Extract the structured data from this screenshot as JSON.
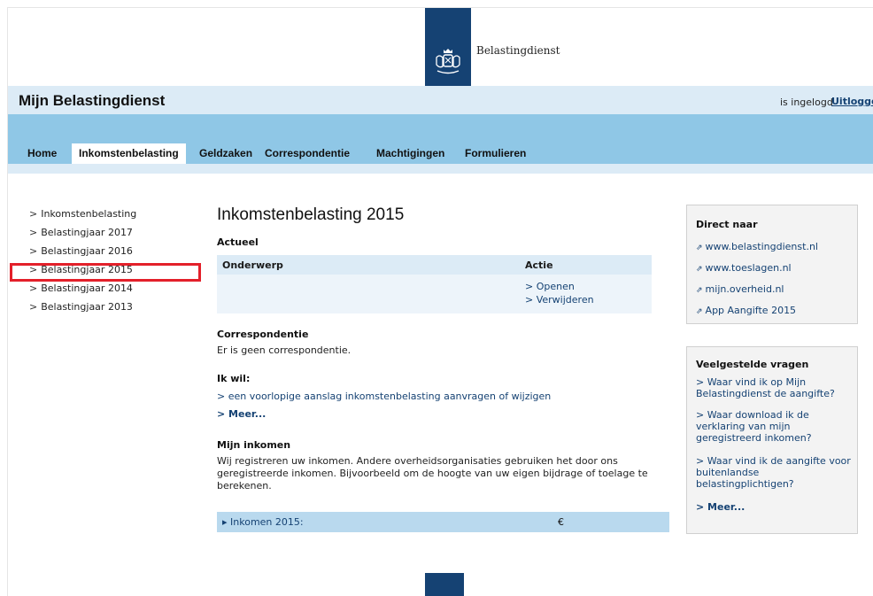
{
  "header": {
    "brand": "Belastingdienst",
    "app_title": "Mijn Belastingdienst",
    "login_status": "is ingelogd",
    "logout_label": "Uitloggen"
  },
  "nav": {
    "tabs": [
      {
        "label": "Home"
      },
      {
        "label": "Inkomstenbelasting",
        "active": true
      },
      {
        "label": "Geldzaken"
      },
      {
        "label": "Correspondentie"
      },
      {
        "label": "Machtigingen"
      },
      {
        "label": "Formulieren"
      }
    ]
  },
  "left_menu": {
    "chevron": ">",
    "items": [
      {
        "label": "Inkomstenbelasting"
      },
      {
        "label": "Belastingjaar 2017"
      },
      {
        "label": "Belastingjaar 2016"
      },
      {
        "label": "Belastingjaar 2015",
        "highlighted": true
      },
      {
        "label": "Belastingjaar 2014"
      },
      {
        "label": "Belastingjaar 2013"
      }
    ]
  },
  "main": {
    "title": "Inkomstenbelasting 2015",
    "actueel": {
      "heading": "Actueel",
      "col_subject": "Onderwerp",
      "col_action": "Actie",
      "actions": [
        "> Openen",
        "> Verwijderen"
      ]
    },
    "correspondentie": {
      "heading": "Correspondentie",
      "text": "Er is geen correspondentie."
    },
    "ik_wil": {
      "heading": "Ik wil:",
      "link": "> een voorlopige aanslag inkomstenbelasting aanvragen of wijzigen",
      "more": "> Meer..."
    },
    "inkomen": {
      "heading": "Mijn inkomen",
      "line1": "Wij registreren uw inkomen. Andere overheidsorganisaties gebruiken het door ons",
      "line2": "geregistreerde inkomen. Bijvoorbeeld om de hoogte van uw eigen bijdrage of toelage te",
      "line3": "berekenen.",
      "bar_label": "▸ Inkomen 2015:",
      "currency": "€"
    }
  },
  "sidebar": {
    "direct": {
      "title": "Direct naar",
      "ext_icon": "⇗",
      "links": [
        "www.belastingdienst.nl",
        "www.toeslagen.nl",
        "mijn.overheid.nl",
        "App Aangifte 2015"
      ]
    },
    "faq": {
      "title": "Veelgestelde vragen",
      "items": [
        "> Waar vind ik op Mijn Belastingdienst de aangifte?",
        "> Waar download ik de verklaring van mijn geregistreerd inkomen?",
        "> Waar vind ik de aangifte voor buitenlandse belastingplichtigen?"
      ],
      "more": "> Meer..."
    }
  },
  "colors": {
    "brand_blue": "#154273",
    "nav_blue": "#8fc7e6",
    "light_blue": "#dcebf6",
    "highlight_red": "#e3202a"
  }
}
